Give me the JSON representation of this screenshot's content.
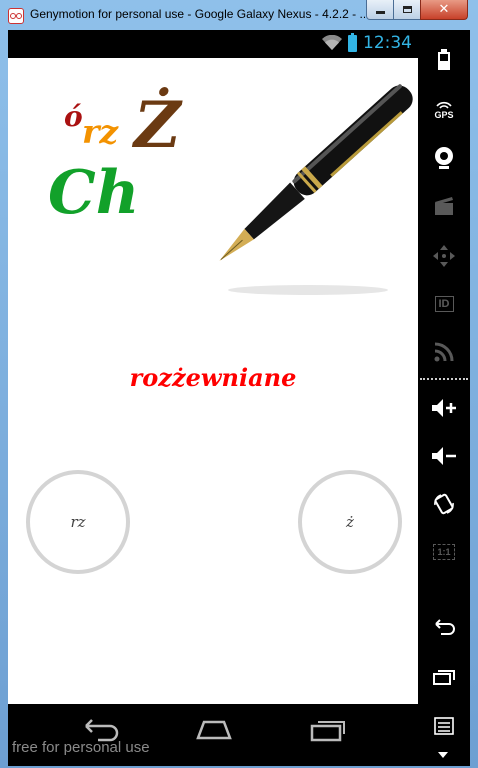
{
  "window": {
    "title": "Genymotion for personal use - Google Galaxy Nexus - 4.2.2 - ...",
    "buttons": {
      "minimize": "minimize",
      "maximize": "maximize",
      "close": "close"
    }
  },
  "statusbar": {
    "time": "12:34",
    "icons": [
      "wifi-icon",
      "battery-icon"
    ]
  },
  "app": {
    "logo_letters": {
      "o": "ó",
      "rz": "rz",
      "z": "Ż",
      "ch": "Ch"
    },
    "word": "rozżewniane",
    "choices": {
      "left": "rz",
      "right": "ż"
    }
  },
  "navbar": {
    "buttons": [
      "back-icon",
      "home-icon",
      "recent-apps-icon"
    ]
  },
  "watermark": "free for personal use",
  "side_toolbar": {
    "items": [
      {
        "icon": "battery-icon"
      },
      {
        "icon": "gps-icon",
        "label": "GPS"
      },
      {
        "icon": "webcam-icon"
      },
      {
        "icon": "clapperboard-icon"
      },
      {
        "icon": "dpad-icon"
      },
      {
        "icon": "id-icon",
        "label": "ID"
      },
      {
        "icon": "rss-icon"
      },
      {
        "icon": "volume-up-icon"
      },
      {
        "icon": "volume-down-icon"
      },
      {
        "icon": "rotate-icon"
      },
      {
        "icon": "pixel-ratio-icon",
        "label": "1:1"
      },
      {
        "icon": "back-arrow-icon"
      },
      {
        "icon": "recent-apps-icon"
      },
      {
        "icon": "menu-icon"
      }
    ]
  },
  "colors": {
    "word": "#ff0000",
    "clock": "#33b5e5",
    "circle_border": "#d4d4d4"
  }
}
